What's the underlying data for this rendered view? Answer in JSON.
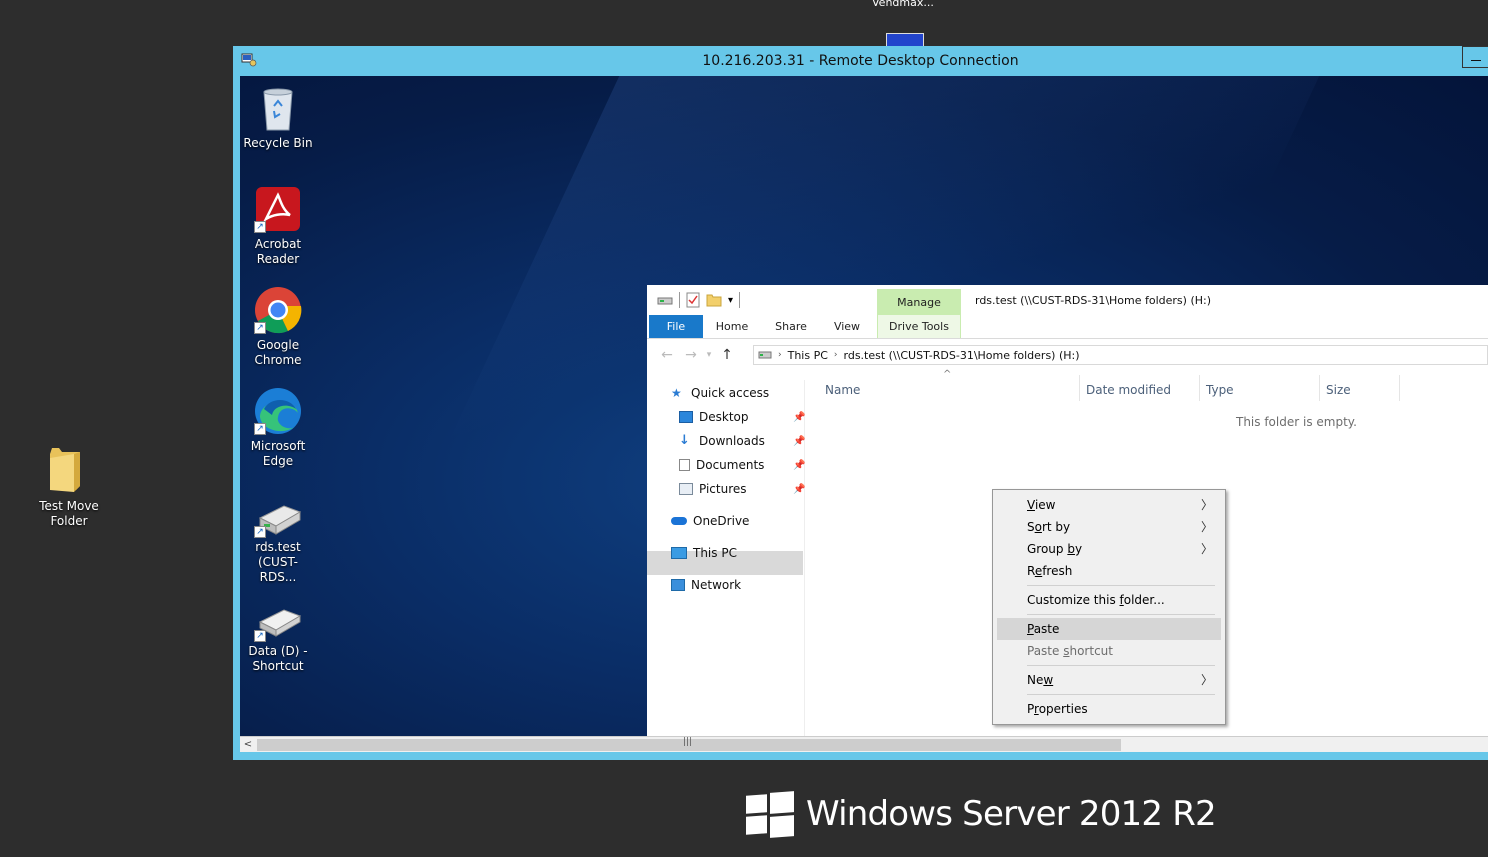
{
  "host": {
    "top_label": "Vendmax...",
    "desktop_icon": {
      "label_line1": "Test Move",
      "label_line2": "Folder"
    },
    "branding": "Windows Server 2012 R2"
  },
  "rdp": {
    "title": "10.216.203.31 - Remote Desktop Connection"
  },
  "remote_desktop": {
    "icons": [
      {
        "line1": "Recycle Bin",
        "line2": ""
      },
      {
        "line1": "Acrobat",
        "line2": "Reader"
      },
      {
        "line1": "Google",
        "line2": "Chrome"
      },
      {
        "line1": "Microsoft",
        "line2": "Edge"
      },
      {
        "line1": "rds.test",
        "line2": "(CUST-RDS..."
      },
      {
        "line1": "Data (D) -",
        "line2": "Shortcut"
      }
    ]
  },
  "explorer": {
    "title": "rds.test (\\\\CUST-RDS-31\\Home folders) (H:)",
    "contextual_tab": "Manage",
    "ribbon_tabs": [
      "File",
      "Home",
      "Share",
      "View",
      "Drive Tools"
    ],
    "breadcrumb": [
      "This PC",
      "rds.test (\\\\CUST-RDS-31\\Home folders) (H:)"
    ],
    "nav": {
      "quick_access": "Quick access",
      "desktop": "Desktop",
      "downloads": "Downloads",
      "documents": "Documents",
      "pictures": "Pictures",
      "onedrive": "OneDrive",
      "this_pc": "This PC",
      "network": "Network"
    },
    "columns": [
      "Name",
      "Date modified",
      "Type",
      "Size"
    ],
    "empty_message": "This folder is empty."
  },
  "context_menu": {
    "view": {
      "pre": "",
      "ul": "V",
      "post": "iew"
    },
    "sort_by": {
      "pre": "S",
      "ul": "o",
      "post": "rt by"
    },
    "group_by": {
      "pre": "Group ",
      "ul": "b",
      "post": "y"
    },
    "refresh": {
      "pre": "R",
      "ul": "e",
      "post": "fresh"
    },
    "customize": {
      "pre": "Customize this ",
      "ul": "f",
      "post": "older..."
    },
    "paste": {
      "pre": "",
      "ul": "P",
      "post": "aste"
    },
    "paste_shortcut": {
      "pre": "Paste ",
      "ul": "s",
      "post": "hortcut"
    },
    "new": {
      "pre": "Ne",
      "ul": "w",
      "post": ""
    },
    "properties": {
      "pre": "P",
      "ul": "r",
      "post": "operties"
    }
  }
}
